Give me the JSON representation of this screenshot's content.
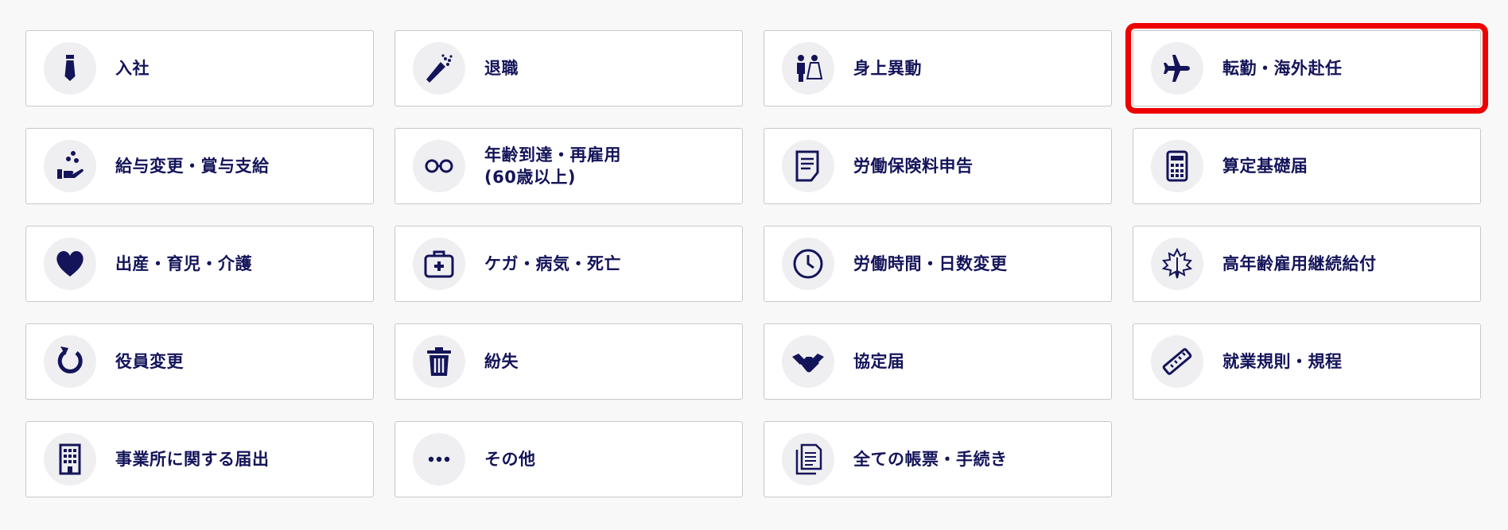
{
  "colors": {
    "text": "#14145a",
    "icon_bg": "#efeff2",
    "border": "#c8c8c8",
    "highlight": "#ee0000",
    "page_bg": "#f8f8f8"
  },
  "cards": [
    {
      "label": "入社",
      "icon": "necktie-icon",
      "selected": false
    },
    {
      "label": "退職",
      "icon": "bouquet-icon",
      "selected": false
    },
    {
      "label": "身上異動",
      "icon": "couple-icon",
      "selected": false
    },
    {
      "label": "転勤・海外赴任",
      "icon": "airplane-icon",
      "selected": true
    },
    {
      "label": "給与変更・賞与支給",
      "icon": "hand-coins-icon",
      "selected": false
    },
    {
      "label": "年齢到達・再雇用",
      "label2": "(60歳以上)",
      "icon": "glasses-icon",
      "selected": false
    },
    {
      "label": "労働保険料申告",
      "icon": "document-icon",
      "selected": false
    },
    {
      "label": "算定基礎届",
      "icon": "calculator-icon",
      "selected": false
    },
    {
      "label": "出産・育児・介護",
      "icon": "heart-icon",
      "selected": false
    },
    {
      "label": "ケガ・病気・死亡",
      "icon": "first-aid-kit-icon",
      "selected": false
    },
    {
      "label": "労働時間・日数変更",
      "icon": "clock-icon",
      "selected": false
    },
    {
      "label": "高年齢雇用継続給付",
      "icon": "maple-leaf-icon",
      "selected": false
    },
    {
      "label": "役員変更",
      "icon": "refresh-icon",
      "selected": false
    },
    {
      "label": "紛失",
      "icon": "trash-icon",
      "selected": false
    },
    {
      "label": "協定届",
      "icon": "handshake-icon",
      "selected": false
    },
    {
      "label": "就業規則・規程",
      "icon": "ruler-icon",
      "selected": false
    },
    {
      "label": "事業所に関する届出",
      "icon": "building-icon",
      "selected": false
    },
    {
      "label": "その他",
      "icon": "more-dots-icon",
      "selected": false
    },
    {
      "label": "全ての帳票・手続き",
      "icon": "documents-icon",
      "selected": false
    }
  ]
}
